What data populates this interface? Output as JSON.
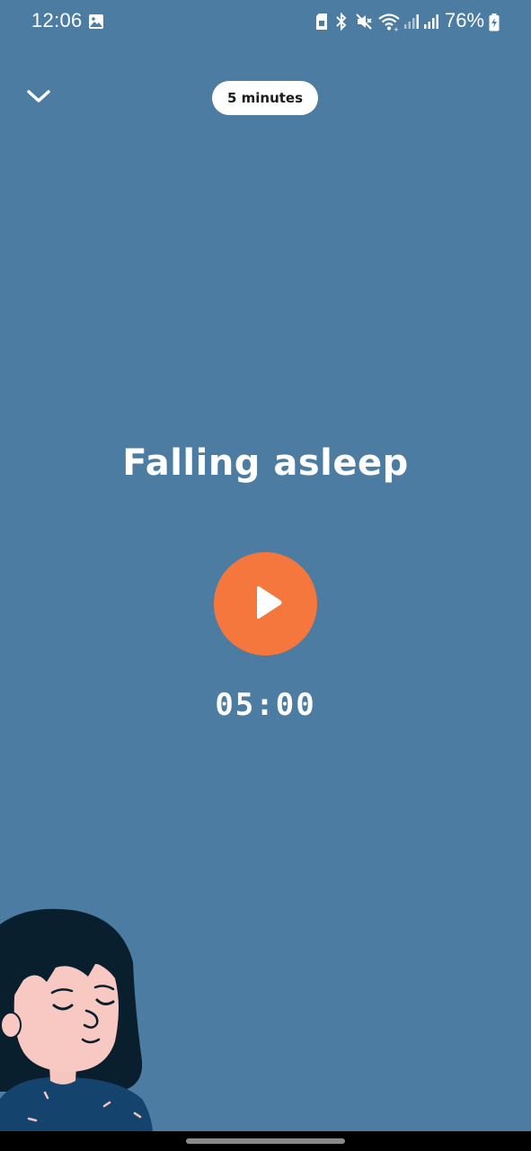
{
  "status_bar": {
    "time": "12:06",
    "battery_percent": "76%",
    "icons": [
      "image-icon",
      "sim-icon",
      "bluetooth-icon",
      "mute-icon",
      "wifi-icon",
      "signal-icon",
      "signal-icon-2",
      "battery-charging-icon"
    ]
  },
  "header": {
    "collapse_icon": "chevron-down-icon",
    "duration_label": "5 minutes"
  },
  "session": {
    "title": "Falling asleep",
    "timer": "05:00",
    "play_icon": "play-icon"
  },
  "colors": {
    "background": "#4c7ca1",
    "accent": "#f5773e",
    "pill_background": "#ffffff",
    "text": "#ffffff"
  }
}
